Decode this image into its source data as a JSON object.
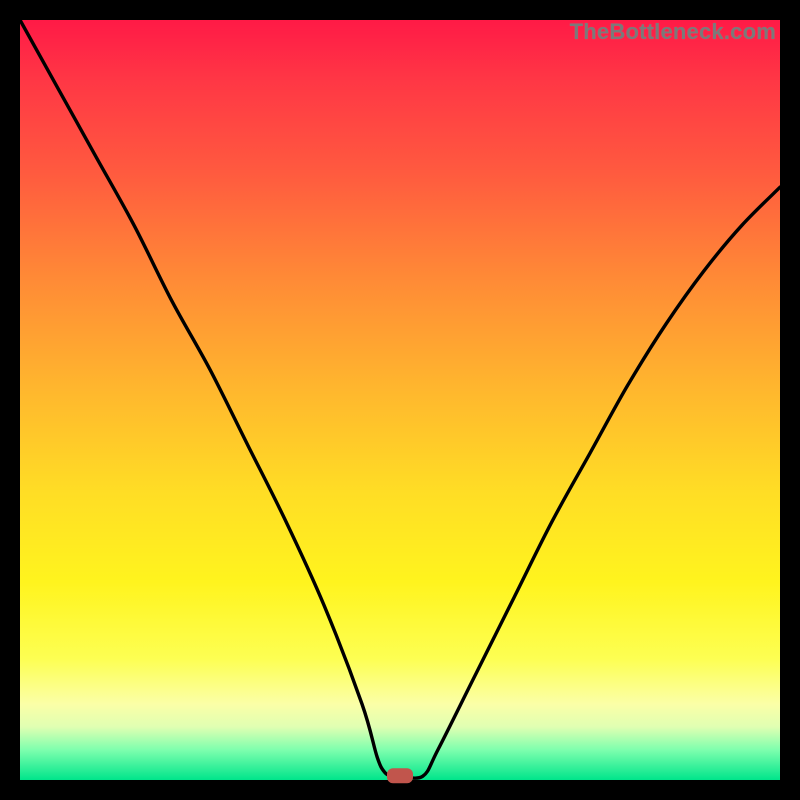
{
  "watermark": "TheBottleneck.com",
  "chart_data": {
    "type": "line",
    "title": "",
    "xlabel": "",
    "ylabel": "",
    "xlim": [
      0,
      100
    ],
    "ylim": [
      0,
      100
    ],
    "series": [
      {
        "name": "bottleneck-curve",
        "x": [
          0,
          5,
          10,
          15,
          20,
          25,
          30,
          35,
          40,
          45,
          47,
          48,
          49,
          50,
          53,
          55,
          60,
          65,
          70,
          75,
          80,
          85,
          90,
          95,
          100
        ],
        "values": [
          100,
          91,
          82,
          73,
          63,
          54,
          44,
          34,
          23,
          10,
          3,
          1,
          0.5,
          0.5,
          0.5,
          4,
          14,
          24,
          34,
          43,
          52,
          60,
          67,
          73,
          78
        ]
      }
    ],
    "marker": {
      "x": 50,
      "y": 0.5,
      "shape": "rounded-rect",
      "color": "#c1554c"
    },
    "gradient_stops": [
      {
        "pos": 0.0,
        "color": "#ff1a46"
      },
      {
        "pos": 0.2,
        "color": "#ff5a3f"
      },
      {
        "pos": 0.48,
        "color": "#ffb52e"
      },
      {
        "pos": 0.74,
        "color": "#fff41e"
      },
      {
        "pos": 0.9,
        "color": "#fbffa7"
      },
      {
        "pos": 1.0,
        "color": "#00e58b"
      }
    ]
  }
}
